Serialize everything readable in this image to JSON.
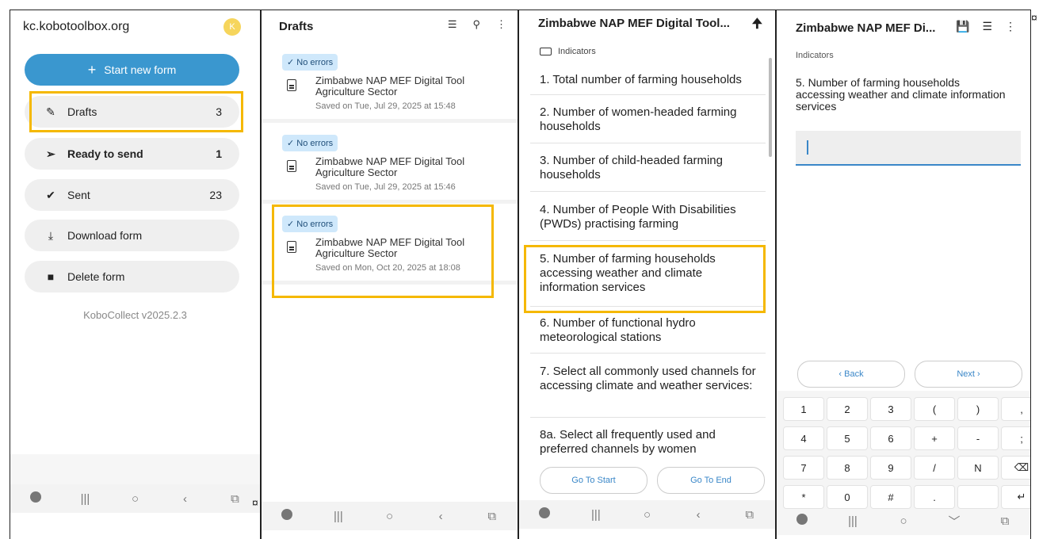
{
  "panel1": {
    "site": "kc.kobotoolbox.org",
    "avatar_letter": "K",
    "start_label": "Start new form",
    "menu": [
      {
        "label": "Drafts",
        "count": "3",
        "icon": "pencil-icon"
      },
      {
        "label": "Ready to send",
        "count": "1",
        "icon": "send-icon"
      },
      {
        "label": "Sent",
        "count": "23",
        "icon": "check-circle-icon"
      },
      {
        "label": "Download form",
        "count": "",
        "icon": "download-icon"
      },
      {
        "label": "Delete form",
        "count": "",
        "icon": "trash-icon"
      }
    ],
    "version": "KoboCollect v2025.2.3"
  },
  "panel2": {
    "title": "Drafts",
    "drafts": [
      {
        "status": "No errors",
        "title": "Zimbabwe NAP MEF Digital Tool Agriculture Sector",
        "saved": "Saved on Tue, Jul 29, 2025 at 15:48"
      },
      {
        "status": "No errors",
        "title": "Zimbabwe NAP MEF Digital Tool Agriculture Sector",
        "saved": "Saved on Tue, Jul 29, 2025 at 15:46"
      },
      {
        "status": "No errors",
        "title": "Zimbabwe NAP MEF Digital Tool Agriculture Sector",
        "saved": "Saved on Mon, Oct 20, 2025 at 18:08"
      }
    ]
  },
  "panel3": {
    "title": "Zimbabwe NAP MEF Digital Tool...",
    "folder": "Indicators",
    "questions": [
      "1. Total number of farming households",
      "2. Number of women-headed farming households",
      "3. Number of child-headed farming households",
      "4. Number of People With Disabilities (PWDs) practising farming",
      "5. Number of farming households accessing weather and climate information services",
      "6. Number of functional hydro meteorological stations",
      "7. Select all commonly used channels for accessing climate and weather services:",
      "8a. Select all frequently used and preferred channels by women"
    ],
    "go_start": "Go To Start",
    "go_end": "Go To End"
  },
  "panel4": {
    "title": "Zimbabwe NAP MEF Di...",
    "section": "Indicators",
    "question": "5. Number of farming households accessing weather and climate information services",
    "back_label": "‹  Back",
    "next_label": "Next  ›",
    "keys": [
      [
        "1",
        "2",
        "3",
        "(",
        ")",
        ","
      ],
      [
        "4",
        "5",
        "6",
        "+",
        "-",
        ";"
      ],
      [
        "7",
        "8",
        "9",
        "/",
        "N",
        "⌫"
      ],
      [
        "*",
        "0",
        "#",
        ".",
        "",
        "↵"
      ]
    ]
  },
  "nav": {
    "recent": "|||",
    "home": "○",
    "back": "‹",
    "down": "﹀",
    "corner": "⧉"
  },
  "marks": {
    "sep": "¤"
  }
}
